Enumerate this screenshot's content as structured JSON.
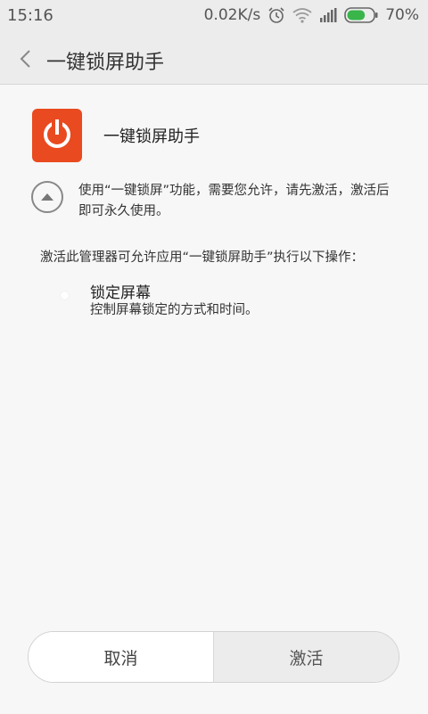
{
  "status_bar": {
    "time": "15:16",
    "network_speed": "0.02K/s",
    "battery_percent": "70%",
    "battery_level": 0.7,
    "icons": [
      "alarm-icon",
      "wifi-icon",
      "signal-icon",
      "battery-icon"
    ]
  },
  "header": {
    "back_icon": "chevron-left-icon",
    "title": "一键锁屏助手"
  },
  "app": {
    "icon": "power-icon",
    "icon_color": "#ea4a1f",
    "name": "一键锁屏助手"
  },
  "notice": {
    "toggle_icon": "triangle-up-icon",
    "text": "使用“一键锁屏”功能，需要您允许，请先激活，激活后即可永久使用。"
  },
  "permissions": {
    "intro": "激活此管理器可允许应用“一键锁屏助手”执行以下操作：",
    "items": [
      {
        "title": "锁定屏幕",
        "description": "控制屏幕锁定的方式和时间。"
      }
    ]
  },
  "actions": {
    "cancel_label": "取消",
    "activate_label": "激活"
  }
}
